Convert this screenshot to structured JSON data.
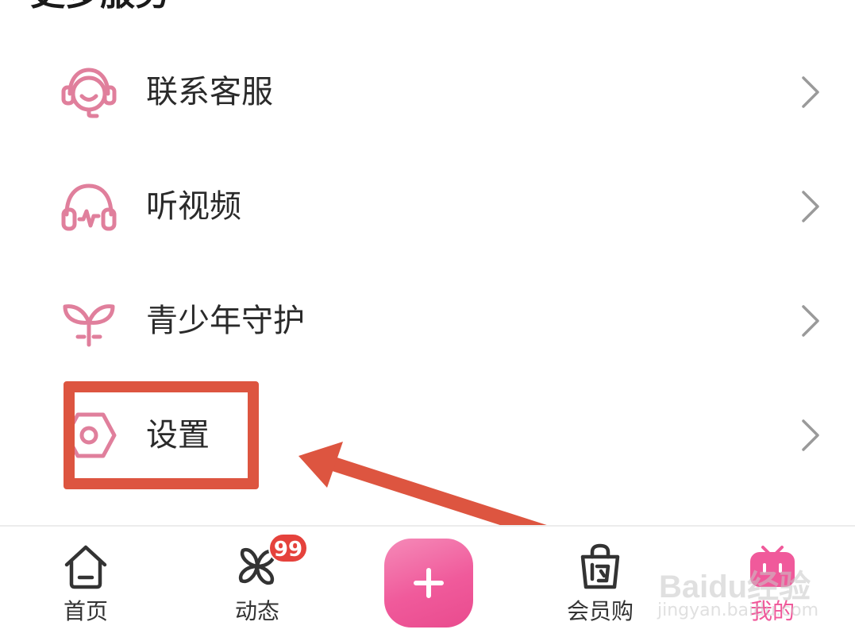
{
  "section": {
    "title": "更多服务"
  },
  "menu": {
    "items": [
      {
        "label": "联系客服",
        "icon": "headset-service-icon"
      },
      {
        "label": "听视频",
        "icon": "headphones-icon"
      },
      {
        "label": "青少年守护",
        "icon": "sprout-icon"
      },
      {
        "label": "设置",
        "icon": "settings-hexagon-icon"
      }
    ]
  },
  "tabbar": {
    "home_label": "首页",
    "feed_label": "动态",
    "shop_label": "会员购",
    "mine_label": "我的",
    "feed_badge": "99",
    "publish_icon": "plus-icon"
  },
  "watermark": {
    "brand": "Baidu经验",
    "sub": "jingyan.baidu.com"
  },
  "colors": {
    "accent_pink": "#f05a9b",
    "icon_pink": "#e07f9c",
    "annotation_red": "#dd5540",
    "badge_red": "#e5423c"
  }
}
